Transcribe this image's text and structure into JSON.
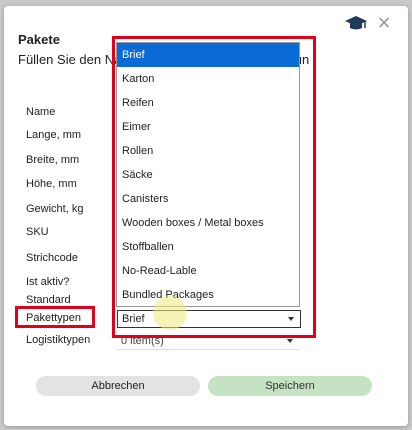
{
  "modal": {
    "title": "Pakete",
    "description": "Füllen Sie den Na                                  KU, Barcode, Art der Verpackun"
  },
  "form": {
    "labels": {
      "name": "Name",
      "length": "Lange, mm",
      "width": "Breite, mm",
      "height": "Höhe, mm",
      "weight": "Gewicht, kg",
      "sku": "SKU",
      "barcode": "Strichcode",
      "active": "Ist aktiv?",
      "standard": "Standard",
      "package_types": "Pakettypen",
      "logistics_types": "Logistiktypen"
    },
    "package_type_value": "Brief",
    "logistics_type_value": "0 item(s)"
  },
  "dropdown": {
    "options": [
      "Brief",
      "Karton",
      "Reifen",
      "Eimer",
      "Rollen",
      "Säcke",
      "Canisters",
      "Wooden boxes / Metal boxes",
      "Stoffballen",
      "No-Read-Lable",
      "Bundled Packages"
    ],
    "selected": "Brief"
  },
  "buttons": {
    "cancel": "Abbrechen",
    "save": "Speichern"
  },
  "icons": {
    "close": "close-icon",
    "cap": "graduation-cap-icon"
  },
  "colors": {
    "highlight": "#e0001a",
    "selected_option": "#0a6ad6",
    "save_button": "#c5e3c3"
  }
}
